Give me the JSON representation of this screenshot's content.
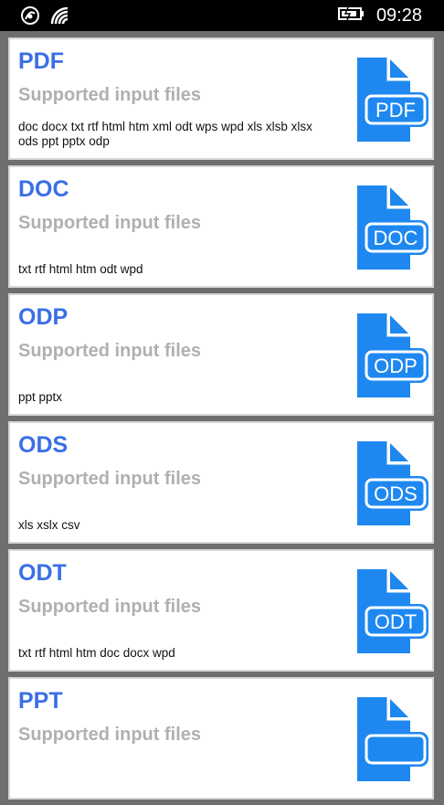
{
  "status": {
    "time": "09:28"
  },
  "cards": [
    {
      "title": "PDF",
      "subtitle": "Supported input files",
      "formats": "doc docx txt rtf html htm xml odt wps wpd xls xlsb xlsx ods ppt pptx odp",
      "icon_label": "PDF"
    },
    {
      "title": "DOC",
      "subtitle": "Supported input files",
      "formats": "txt rtf html htm odt wpd",
      "icon_label": "DOC"
    },
    {
      "title": "ODP",
      "subtitle": "Supported input files",
      "formats": "ppt pptx",
      "icon_label": "ODP"
    },
    {
      "title": "ODS",
      "subtitle": "Supported input files",
      "formats": "xls xslx csv",
      "icon_label": "ODS"
    },
    {
      "title": "ODT",
      "subtitle": "Supported input files",
      "formats": "txt rtf html htm doc docx wpd",
      "icon_label": "ODT"
    },
    {
      "title": "PPT",
      "subtitle": "Supported input files",
      "formats": "",
      "icon_label": ""
    }
  ],
  "colors": {
    "accent": "#3a6ee6",
    "icon": "#1e88f0",
    "subtitle": "#b0b0b0"
  }
}
